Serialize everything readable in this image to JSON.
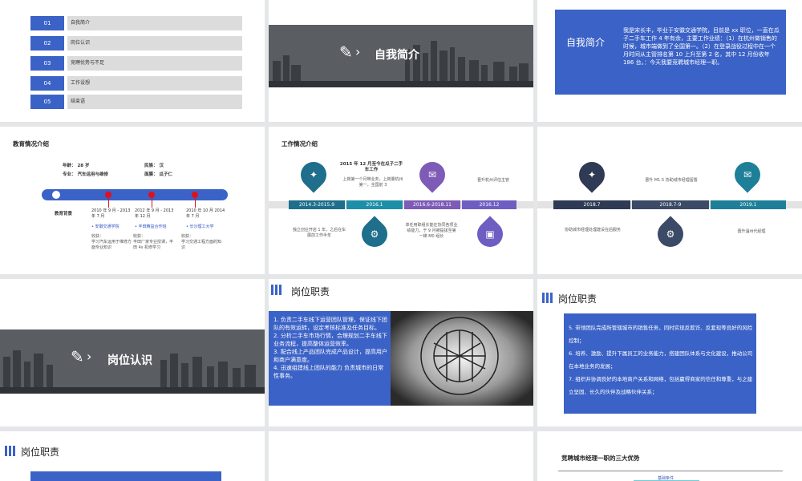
{
  "slide1": {
    "toc": [
      {
        "num": "01",
        "label": "自我简介"
      },
      {
        "num": "02",
        "label": "岗位认识"
      },
      {
        "num": "03",
        "label": "竞聘优势与不足"
      },
      {
        "num": "04",
        "label": "工作设想"
      },
      {
        "num": "05",
        "label": "结束语"
      }
    ]
  },
  "slide2": {
    "title": "自我简介"
  },
  "slide3": {
    "title": "自我简介",
    "text": "我是宋长丰，毕业于安徽交通学院，目前是 xx 职位，一直在瓜子二手车工作 4 年有余，主要工作业绩：（1）在杭州做销售的时候，城市端做到了全国第一。（2）在登录战役过程中在一个月时间从主管排名第 10 上升至第 2 名，其中 12 月份收年 186 台。：今天我要竞聘城市经理一职。"
  },
  "slide4": {
    "title": "教育情况介绍",
    "age_label": "年龄：",
    "age": "28 岁",
    "nation_label": "民族：",
    "nation": "汉",
    "major_label": "专业：",
    "major": "汽车运用与维修",
    "company_label": "面膜：",
    "company": "瓜子仁",
    "bg_label": "教育背景",
    "items": [
      {
        "date": "2010 年 9 月 - 2013 年 7 月",
        "school": "安徽交通学院",
        "note": "收获：\n学习汽车运用于维修方面专业知识"
      },
      {
        "date": "2012 年 9 月 - 2013 年 12 月",
        "school": "丰田精益合作班",
        "note": "收获：\n丰田厂家专业授课，丰田 4s 机修学习"
      },
      {
        "date": "2010 年 10 月 2014 年 7 月",
        "school": "长沙理工大学",
        "note": "收获：\n学习交通工程方面的知识"
      }
    ]
  },
  "slide5": {
    "title": "工作情况介绍",
    "highlight": "2015 年 12 月至今在瓜子二手车工作",
    "highlight_sub": "上岗第一个月带业务，上岗量杭州第一，全国前 3",
    "chips": [
      "2014.3-2015.9",
      "2016.1",
      "2016.6-2018.11",
      "2016.12"
    ],
    "chip_colors": [
      "#1e6e8c",
      "#1e8fa8",
      "#7d5bb6",
      "#6f5ec2"
    ],
    "notes": [
      "独立创业开店 1 年，之后在车展前工作半年",
      "单任用职组长能在协同各项业绩能力，于 9 月被提拔至第一梯 M0 组长",
      "晋升杭州评估主管"
    ]
  },
  "slide6": {
    "chips": [
      "2018.7",
      "2018.7-9",
      "2019.1"
    ],
    "chip_colors": [
      "#2f3a55",
      "#3b4a66",
      "#1e7f99"
    ],
    "notes": [
      "协助城市经理处理建设在后服务",
      "晋升 M1.5 协助城市经理留置",
      "晋升温州代经理"
    ]
  },
  "slide7": {
    "title": "岗位认识"
  },
  "slide8": {
    "title": "岗位职责",
    "text": "1. 负责二手车线下运营团队管理，保证线下团队的有效运转，设定考核标准及任务目标。\n2. 分析二手车市场行情，合理规划二手车线下业务流程，提高整体运营效率。\n3. 配合线上产品团队完成产品设计，提高用户和商户满意度。\n4. 迅速组建线上团队的能力 负责城市的日常性事务。"
  },
  "slide9": {
    "title": "岗位职责",
    "text": "5. 带领团队完成所管辖城市的销售任务，同时实现反欺诈、反套现等良好的风险控制；\n6. 培养、激励、提升下属员工的业务能力，搭建团队体系与文化建设，推动公司在本地业务的发展；\n7. 组织并协调良好的本地商户关系和网络，包括赢得商家的信任和尊重，与之建立坚固、长久的伙伴及战略伙伴关系；"
  },
  "slide10": {
    "title": "岗位职责"
  },
  "slide12": {
    "title": "竞聘城市经理一职的三大优势",
    "sub": "基础条件"
  },
  "icons": {
    "bulb": "lightbulb-icon",
    "mail": "mail-icon",
    "gear": "gear-icon",
    "briefcase": "briefcase-icon",
    "pen": "pen-icon"
  },
  "colors": {
    "accent": "#3b62c6"
  }
}
